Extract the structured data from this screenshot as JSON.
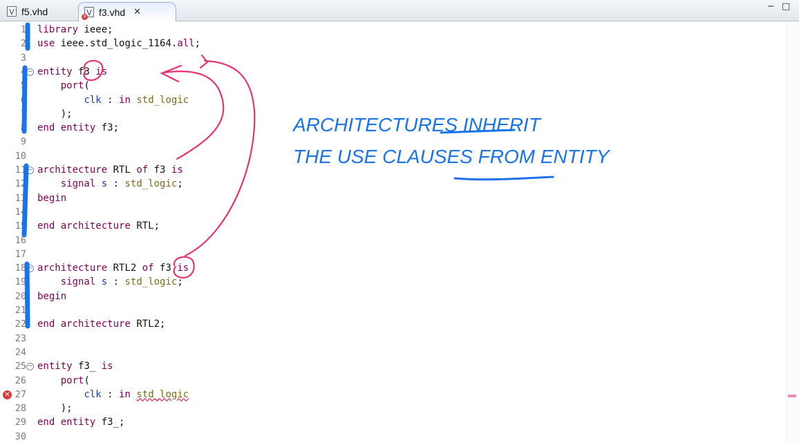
{
  "tabs": [
    {
      "label": "f5.vhd",
      "icon": "vhdl-file-icon",
      "active": false
    },
    {
      "label": "f3.vhd",
      "icon": "vhdl-file-error-icon",
      "active": true
    }
  ],
  "window_controls": {
    "minimize": "−",
    "maximize": "□"
  },
  "code": {
    "lines": [
      {
        "n": "1",
        "t": "library ieee;"
      },
      {
        "n": "2",
        "t": "use ieee.std_logic_1164.all;"
      },
      {
        "n": "3",
        "t": ""
      },
      {
        "n": "4",
        "t": "entity f3 is",
        "fold": true
      },
      {
        "n": "5",
        "t": "    port("
      },
      {
        "n": "6",
        "t": "        clk : in std_logic"
      },
      {
        "n": "7",
        "t": "    );"
      },
      {
        "n": "8",
        "t": "end entity f3;"
      },
      {
        "n": "9",
        "t": ""
      },
      {
        "n": "10",
        "t": ""
      },
      {
        "n": "11",
        "t": "architecture RTL of f3 is",
        "fold": true
      },
      {
        "n": "12",
        "t": "    signal s : std_logic;"
      },
      {
        "n": "13",
        "t": "begin"
      },
      {
        "n": "14",
        "t": ""
      },
      {
        "n": "15",
        "t": "end architecture RTL;"
      },
      {
        "n": "16",
        "t": ""
      },
      {
        "n": "17",
        "t": ""
      },
      {
        "n": "18",
        "t": "architecture RTL2 of f3 is",
        "fold": true
      },
      {
        "n": "19",
        "t": "    signal s : std_logic;"
      },
      {
        "n": "20",
        "t": "begin"
      },
      {
        "n": "21",
        "t": ""
      },
      {
        "n": "22",
        "t": "end architecture RTL2;"
      },
      {
        "n": "23",
        "t": ""
      },
      {
        "n": "24",
        "t": ""
      },
      {
        "n": "25",
        "t": "entity f3_ is",
        "fold": true
      },
      {
        "n": "26",
        "t": "    port("
      },
      {
        "n": "27",
        "t": "        clk : in std_logic",
        "error": true
      },
      {
        "n": "28",
        "t": "    );"
      },
      {
        "n": "29",
        "t": "end entity f3_;"
      },
      {
        "n": "30",
        "t": ""
      }
    ]
  },
  "annotation": {
    "line1": "ARCHITECTURES INHERIT",
    "line2": "THE USE CLAUSES FROM ENTITY",
    "pen_blue": "#1a73e8",
    "pen_pink": "#e8336f"
  }
}
